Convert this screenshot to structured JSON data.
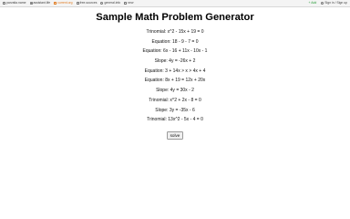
{
  "topbar": {
    "items": [
      {
        "label": "parvatia.name",
        "icon": "bookmark-icon"
      },
      {
        "label": "assistant.life",
        "icon": "bookmark-icon"
      },
      {
        "label": "current.org",
        "icon": "bookmark-icon",
        "active": true
      },
      {
        "label": "free-sources",
        "icon": "folder-icon"
      },
      {
        "label": "general.info",
        "icon": "globe-icon"
      },
      {
        "label": "new",
        "icon": "plus-icon"
      }
    ],
    "right": [
      {
        "label": "+ Add",
        "icon": "add-icon"
      },
      {
        "label": "Sign in / Sign up",
        "icon": "user-icon"
      }
    ]
  },
  "main": {
    "title": "Sample Math Problem Generator",
    "problems": [
      "Trinomial: x^2 - 15x + 19 = 0",
      "Equation: 18 - 9 - 7 = 0",
      "Equation: 6x - 16 + 11x - 10x - 1",
      "Slope: 4y = -26x + 2",
      "Equation: 3 + 14x > x > 4x + 4",
      "Equation: 8x + 19 = 12x + 20x",
      "Slope: 4y = 30x - 2",
      "Trinomial: x^2 + 2x - 8 = 0",
      "Slope: 3y = -35x - 6",
      "Trinomial: 13x^2 - 5x - 4 = 0"
    ],
    "solve_label": "solve"
  }
}
